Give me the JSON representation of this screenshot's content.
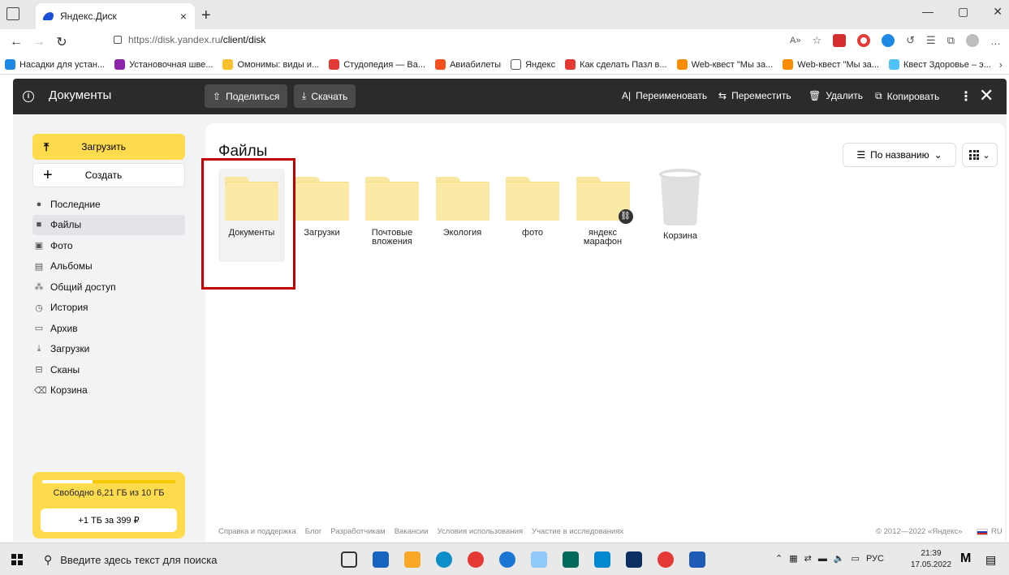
{
  "browser": {
    "tab_title": "Яндекс.Диск",
    "tab_close": "×",
    "new_tab": "+",
    "url_host": "https://disk.yandex.ru",
    "url_path": "/client/disk",
    "bookmarks": [
      {
        "label": "Насадки для устан...",
        "color": "#1e88e5"
      },
      {
        "label": "Установочная шве...",
        "color": "#8e24aa"
      },
      {
        "label": "Омонимы: виды и...",
        "color": "#fbc02d"
      },
      {
        "label": "Студопедия — Ва...",
        "color": "#e53935"
      },
      {
        "label": "Авиабилеты",
        "color": "#f4511e"
      },
      {
        "label": "Яндекс",
        "color": "#ffffff"
      },
      {
        "label": "Как сделать Пазл в...",
        "color": "#e53935"
      },
      {
        "label": "Web-квест \"Мы за...",
        "color": "#fb8c00"
      },
      {
        "label": "Web-квест \"Мы за...",
        "color": "#fb8c00"
      },
      {
        "label": "Квест Здоровье – э...",
        "color": "#4fc3f7"
      }
    ]
  },
  "header": {
    "title": "Документы",
    "share_label": "Поделиться",
    "download_label": "Скачать",
    "rename_label": "Переименовать",
    "move_label": "Переместить",
    "delete_label": "Удалить",
    "copy_label": "Копировать"
  },
  "sidebar": {
    "upload_label": "Загрузить",
    "create_label": "Создать",
    "items": [
      {
        "label": "Последние",
        "icon": "●",
        "active": false
      },
      {
        "label": "Файлы",
        "icon": "■",
        "active": true
      },
      {
        "label": "Фото",
        "icon": "▣",
        "active": false
      },
      {
        "label": "Альбомы",
        "icon": "▤",
        "active": false
      },
      {
        "label": "Общий доступ",
        "icon": "⁂",
        "active": false
      },
      {
        "label": "История",
        "icon": "◷",
        "active": false
      },
      {
        "label": "Архив",
        "icon": "▭",
        "active": false
      },
      {
        "label": "Загрузки",
        "icon": "⤓",
        "active": false
      },
      {
        "label": "Сканы",
        "icon": "⊟",
        "active": false
      },
      {
        "label": "Корзина",
        "icon": "⌫",
        "active": false
      }
    ],
    "storage_text": "Свободно 6,21 ГБ из 10 ГБ",
    "storage_used_fraction": 0.379,
    "buy_label": "+1 ТБ за 399 ₽"
  },
  "main": {
    "title": "Файлы",
    "sort_label": "По названию",
    "folders": [
      {
        "name": "Документы",
        "selected": true,
        "shared": false
      },
      {
        "name": "Загрузки",
        "selected": false,
        "shared": false
      },
      {
        "name": "Почтовые вложения",
        "selected": false,
        "shared": false
      },
      {
        "name": "Экология",
        "selected": false,
        "shared": false
      },
      {
        "name": "фото",
        "selected": false,
        "shared": false
      },
      {
        "name": "яндекс марафон",
        "selected": false,
        "shared": true
      }
    ],
    "trash_name": "Корзина"
  },
  "footer": {
    "links": [
      "Справка и поддержка",
      "Блог",
      "Разработчикам",
      "Вакансии",
      "Условия использования",
      "Участие в исследованиях"
    ],
    "copyright": "© 2012—2022 «Яндекс»",
    "lang": "RU"
  },
  "taskbar": {
    "search_placeholder": "Введите здесь текст для поиска",
    "lang": "РУС",
    "time": "21:39",
    "date": "17.05.2022"
  },
  "colors": {
    "accent_yellow": "#ffdb4d",
    "header_dark": "#2b2b2b",
    "highlight_red": "#c00000"
  }
}
